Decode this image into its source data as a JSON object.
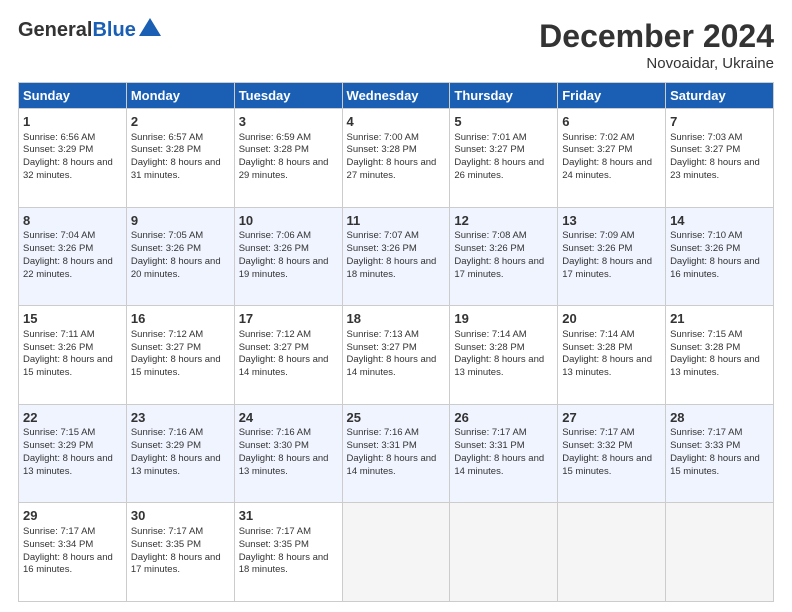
{
  "header": {
    "logo_general": "General",
    "logo_blue": "Blue",
    "month_title": "December 2024",
    "location": "Novoaidar, Ukraine"
  },
  "weekdays": [
    "Sunday",
    "Monday",
    "Tuesday",
    "Wednesday",
    "Thursday",
    "Friday",
    "Saturday"
  ],
  "weeks": [
    [
      {
        "day": "1",
        "sunrise": "6:56 AM",
        "sunset": "3:29 PM",
        "daylight": "8 hours and 32 minutes."
      },
      {
        "day": "2",
        "sunrise": "6:57 AM",
        "sunset": "3:28 PM",
        "daylight": "8 hours and 31 minutes."
      },
      {
        "day": "3",
        "sunrise": "6:59 AM",
        "sunset": "3:28 PM",
        "daylight": "8 hours and 29 minutes."
      },
      {
        "day": "4",
        "sunrise": "7:00 AM",
        "sunset": "3:28 PM",
        "daylight": "8 hours and 27 minutes."
      },
      {
        "day": "5",
        "sunrise": "7:01 AM",
        "sunset": "3:27 PM",
        "daylight": "8 hours and 26 minutes."
      },
      {
        "day": "6",
        "sunrise": "7:02 AM",
        "sunset": "3:27 PM",
        "daylight": "8 hours and 24 minutes."
      },
      {
        "day": "7",
        "sunrise": "7:03 AM",
        "sunset": "3:27 PM",
        "daylight": "8 hours and 23 minutes."
      }
    ],
    [
      {
        "day": "8",
        "sunrise": "7:04 AM",
        "sunset": "3:26 PM",
        "daylight": "8 hours and 22 minutes."
      },
      {
        "day": "9",
        "sunrise": "7:05 AM",
        "sunset": "3:26 PM",
        "daylight": "8 hours and 20 minutes."
      },
      {
        "day": "10",
        "sunrise": "7:06 AM",
        "sunset": "3:26 PM",
        "daylight": "8 hours and 19 minutes."
      },
      {
        "day": "11",
        "sunrise": "7:07 AM",
        "sunset": "3:26 PM",
        "daylight": "8 hours and 18 minutes."
      },
      {
        "day": "12",
        "sunrise": "7:08 AM",
        "sunset": "3:26 PM",
        "daylight": "8 hours and 17 minutes."
      },
      {
        "day": "13",
        "sunrise": "7:09 AM",
        "sunset": "3:26 PM",
        "daylight": "8 hours and 17 minutes."
      },
      {
        "day": "14",
        "sunrise": "7:10 AM",
        "sunset": "3:26 PM",
        "daylight": "8 hours and 16 minutes."
      }
    ],
    [
      {
        "day": "15",
        "sunrise": "7:11 AM",
        "sunset": "3:26 PM",
        "daylight": "8 hours and 15 minutes."
      },
      {
        "day": "16",
        "sunrise": "7:12 AM",
        "sunset": "3:27 PM",
        "daylight": "8 hours and 15 minutes."
      },
      {
        "day": "17",
        "sunrise": "7:12 AM",
        "sunset": "3:27 PM",
        "daylight": "8 hours and 14 minutes."
      },
      {
        "day": "18",
        "sunrise": "7:13 AM",
        "sunset": "3:27 PM",
        "daylight": "8 hours and 14 minutes."
      },
      {
        "day": "19",
        "sunrise": "7:14 AM",
        "sunset": "3:28 PM",
        "daylight": "8 hours and 13 minutes."
      },
      {
        "day": "20",
        "sunrise": "7:14 AM",
        "sunset": "3:28 PM",
        "daylight": "8 hours and 13 minutes."
      },
      {
        "day": "21",
        "sunrise": "7:15 AM",
        "sunset": "3:28 PM",
        "daylight": "8 hours and 13 minutes."
      }
    ],
    [
      {
        "day": "22",
        "sunrise": "7:15 AM",
        "sunset": "3:29 PM",
        "daylight": "8 hours and 13 minutes."
      },
      {
        "day": "23",
        "sunrise": "7:16 AM",
        "sunset": "3:29 PM",
        "daylight": "8 hours and 13 minutes."
      },
      {
        "day": "24",
        "sunrise": "7:16 AM",
        "sunset": "3:30 PM",
        "daylight": "8 hours and 13 minutes."
      },
      {
        "day": "25",
        "sunrise": "7:16 AM",
        "sunset": "3:31 PM",
        "daylight": "8 hours and 14 minutes."
      },
      {
        "day": "26",
        "sunrise": "7:17 AM",
        "sunset": "3:31 PM",
        "daylight": "8 hours and 14 minutes."
      },
      {
        "day": "27",
        "sunrise": "7:17 AM",
        "sunset": "3:32 PM",
        "daylight": "8 hours and 15 minutes."
      },
      {
        "day": "28",
        "sunrise": "7:17 AM",
        "sunset": "3:33 PM",
        "daylight": "8 hours and 15 minutes."
      }
    ],
    [
      {
        "day": "29",
        "sunrise": "7:17 AM",
        "sunset": "3:34 PM",
        "daylight": "8 hours and 16 minutes."
      },
      {
        "day": "30",
        "sunrise": "7:17 AM",
        "sunset": "3:35 PM",
        "daylight": "8 hours and 17 minutes."
      },
      {
        "day": "31",
        "sunrise": "7:17 AM",
        "sunset": "3:35 PM",
        "daylight": "8 hours and 18 minutes."
      },
      null,
      null,
      null,
      null
    ]
  ]
}
